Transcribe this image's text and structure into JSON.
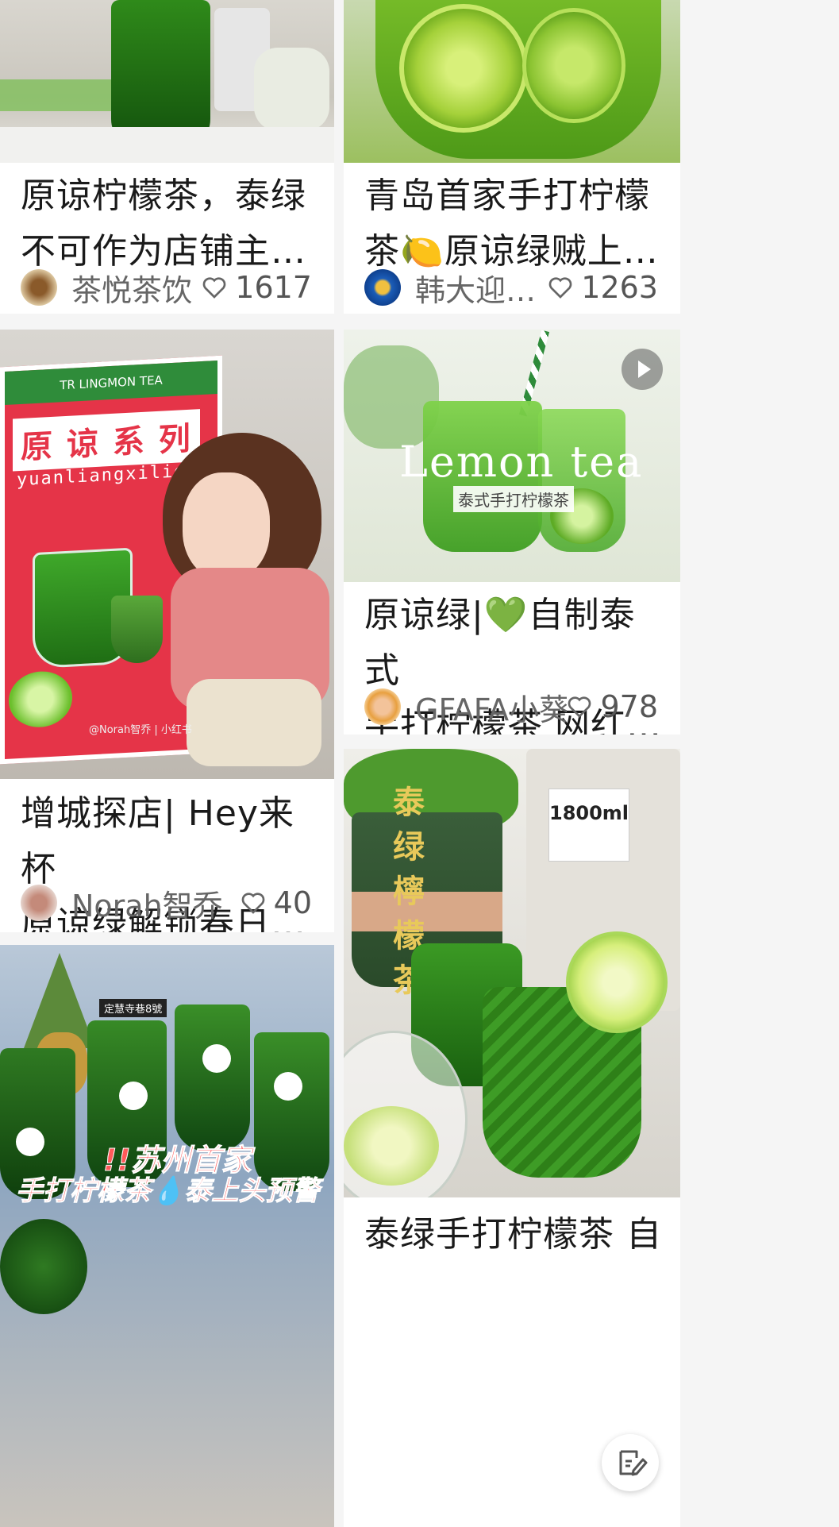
{
  "feed": {
    "cards": [
      {
        "title": "原谅柠檬茶，泰绿\n不可作为店铺主…",
        "author": "茶悦茶饮",
        "likes": "1617"
      },
      {
        "title": "青岛首家手打柠檬\n茶🍋原谅绿贼上…",
        "author": "韩大迎…",
        "likes": "1263"
      },
      {
        "title": "增城探店| Hey来杯\n原谅绿解锁春日…",
        "author": "Norah智乔",
        "likes": "40",
        "image_texts": {
          "brand": "TR LINGMON TEA",
          "series": "原 谅 系 列",
          "pinyin": "yuanliangxilie",
          "watermark": "@Norah智乔 | 小红书"
        }
      },
      {
        "title": "原谅绿|💚自制泰式\n手打柠檬茶 网红…",
        "author": "GFAFA小葵",
        "likes": "978",
        "image_texts": {
          "script": "Lemon tea",
          "caption": "泰式手打柠檬茶"
        }
      },
      {
        "image_texts": {
          "headline1": "!!苏州首家",
          "headline2": "手打柠檬茶💧泰上头预警",
          "store_tag": "定慧寺巷8號"
        }
      },
      {
        "title": "泰绿手打柠檬茶 自",
        "image_texts": {
          "vertical": "泰绿檸檬茶",
          "jar_label": "1800ml"
        }
      }
    ]
  },
  "colors": {
    "background": "#f5f5f5",
    "card": "#ffffff",
    "drink_green": "#3c8a1e",
    "text": "#1a1a1a",
    "meta": "#666666"
  },
  "icons": {
    "like": "heart-outline-icon",
    "play": "play-icon",
    "edit": "edit-note-icon"
  }
}
